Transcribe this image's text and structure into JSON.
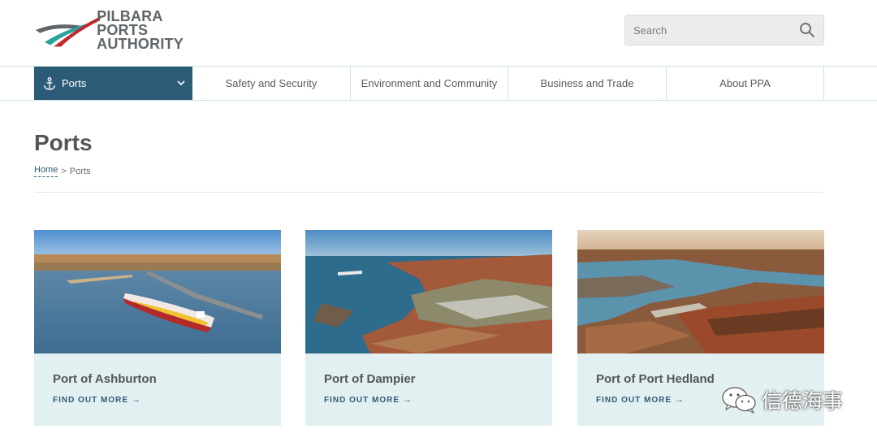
{
  "brand": {
    "line1": "PILBARA PORTS",
    "line2": "AUTHORITY",
    "colors": {
      "accent_red": "#c0282d",
      "accent_teal": "#2aa39a",
      "dark_gray": "#5f6568"
    }
  },
  "search": {
    "placeholder": "Search",
    "icon": "search-icon"
  },
  "nav": {
    "items": [
      {
        "label": "Ports",
        "icon": "anchor-icon",
        "active": true
      },
      {
        "label": "Safety and Security"
      },
      {
        "label": "Environment and Community"
      },
      {
        "label": "Business and Trade"
      },
      {
        "label": "About PPA"
      }
    ],
    "active_color": "#2c5b78"
  },
  "page": {
    "title": "Ports",
    "breadcrumb": {
      "home": "Home",
      "separator": ">",
      "current": "Ports"
    }
  },
  "cards": [
    {
      "name": "Port of Ashburton",
      "cta": "FIND OUT MORE",
      "arrow": "→"
    },
    {
      "name": "Port of Dampier",
      "cta": "FIND OUT MORE",
      "arrow": "→"
    },
    {
      "name": "Port of Port Hedland",
      "cta": "FIND OUT MORE",
      "arrow": "→"
    }
  ],
  "watermark": {
    "text": "信德海事",
    "icon": "wechat-icon"
  }
}
